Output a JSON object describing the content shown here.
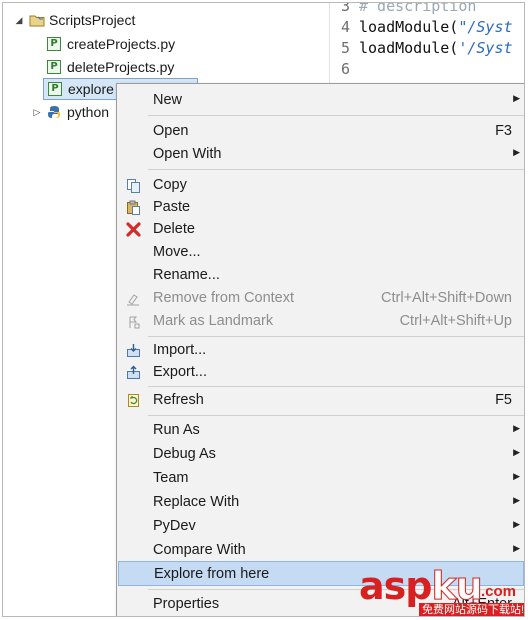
{
  "tree": {
    "project": "ScriptsProject",
    "files": [
      "createProjects.py",
      "deleteProjects.py",
      "explore"
    ],
    "folder": "python"
  },
  "editor": {
    "lines": [
      {
        "num": "3",
        "comment": "# description"
      },
      {
        "num": "4",
        "fn": "loadModule(",
        "str": "\"/Syst"
      },
      {
        "num": "5",
        "fn": "loadModule(",
        "str": "'/Syst"
      },
      {
        "num": "6"
      }
    ]
  },
  "menu": {
    "items": [
      {
        "label": "New",
        "accel": "",
        "submenu": true
      },
      {
        "label": "Open",
        "accel": "F3"
      },
      {
        "label": "Open With",
        "accel": "",
        "submenu": true
      },
      {
        "label": "Copy",
        "accel": "",
        "icon": "copy-icon"
      },
      {
        "label": "Paste",
        "accel": "",
        "icon": "paste-icon"
      },
      {
        "label": "Delete",
        "accel": "",
        "icon": "delete-icon"
      },
      {
        "label": "Move...",
        "accel": ""
      },
      {
        "label": "Rename...",
        "accel": ""
      },
      {
        "label": "Remove from Context",
        "accel": "Ctrl+Alt+Shift+Down",
        "disabled": true,
        "icon": "remove-context-icon"
      },
      {
        "label": "Mark as Landmark",
        "accel": "Ctrl+Alt+Shift+Up",
        "disabled": true,
        "icon": "landmark-icon"
      },
      {
        "label": "Import...",
        "accel": "",
        "icon": "import-icon"
      },
      {
        "label": "Export...",
        "accel": "",
        "icon": "export-icon"
      },
      {
        "label": "Refresh",
        "accel": "F5",
        "icon": "refresh-icon"
      },
      {
        "label": "Run As",
        "accel": "",
        "submenu": true
      },
      {
        "label": "Debug As",
        "accel": "",
        "submenu": true
      },
      {
        "label": "Team",
        "accel": "",
        "submenu": true
      },
      {
        "label": "Replace With",
        "accel": "",
        "submenu": true
      },
      {
        "label": "PyDev",
        "accel": "",
        "submenu": true
      },
      {
        "label": "Compare With",
        "accel": "",
        "submenu": true
      },
      {
        "label": "Explore from here",
        "accel": "",
        "highlighted": true
      },
      {
        "label": "Properties",
        "accel": "Alt+Enter"
      }
    ]
  },
  "watermark": {
    "brand_a": "asp",
    "brand_b": "ku",
    "tld": ".com",
    "tagline": "免费网站源码下载站!"
  },
  "colors": {
    "highlight": "#c4dbf3",
    "watermark": "#d82020",
    "string": "#2a6bc3"
  }
}
